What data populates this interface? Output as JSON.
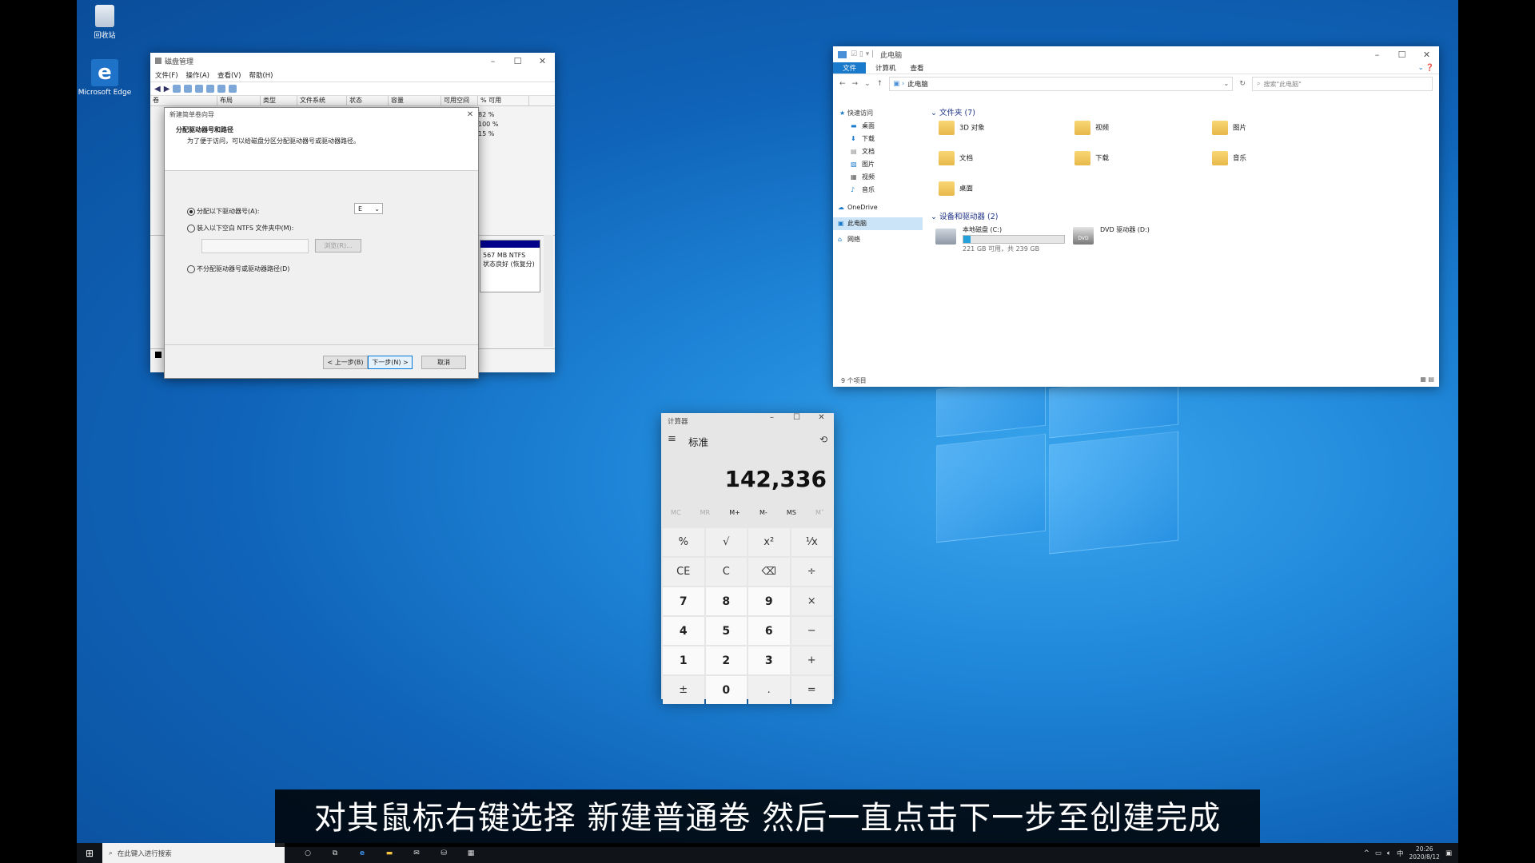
{
  "desktop": {
    "icons": [
      {
        "label": "回收站",
        "icon": "recycle-bin-icon"
      },
      {
        "label": "Microsoft Edge",
        "icon": "edge-icon"
      }
    ]
  },
  "disk_mgmt": {
    "title": "磁盘管理",
    "menu": [
      "文件(F)",
      "操作(A)",
      "查看(V)",
      "帮助(H)"
    ],
    "columns": [
      "卷",
      "布局",
      "类型",
      "文件系统",
      "状态",
      "容量",
      "可用空间",
      "% 可用"
    ],
    "pct_values": [
      "82 %",
      "100 %",
      "15 %"
    ],
    "partition_label": "567 MB NTFS",
    "partition_status": "状态良好 (恢复分)"
  },
  "wizard": {
    "title": "新建简单卷向导",
    "heading": "分配驱动器号和路径",
    "desc": "为了便于访问，可以给磁盘分区分配驱动器号或驱动器路径。",
    "opt1": "分配以下驱动器号(A):",
    "opt2": "装入以下空白 NTFS 文件夹中(M):",
    "opt3": "不分配驱动器号或驱动器路径(D)",
    "drive_letter": "E",
    "browse": "浏览(R)...",
    "back": "< 上一步(B)",
    "next": "下一步(N) >",
    "cancel": "取消"
  },
  "explorer": {
    "title": "此电脑",
    "ribbon_tabs": [
      "文件",
      "计算机",
      "查看"
    ],
    "address": "此电脑",
    "search_placeholder": "搜索\"此电脑\"",
    "nav": [
      "快速访问",
      "桌面",
      "下载",
      "文档",
      "图片",
      "视频",
      "音乐",
      "OneDrive",
      "此电脑",
      "网络"
    ],
    "folders_header": "文件夹 (7)",
    "folders": [
      "3D 对象",
      "视频",
      "图片",
      "文档",
      "下载",
      "音乐",
      "桌面"
    ],
    "devices_header": "设备和驱动器 (2)",
    "drive_c": "本地磁盘 (C:)",
    "drive_c_space": "221 GB 可用，共 239 GB",
    "drive_c_used_fraction": 0.075,
    "drive_d": "DVD 驱动器 (D:)",
    "status": "9 个项目"
  },
  "calculator": {
    "title": "计算器",
    "mode": "标准",
    "display": "142,336",
    "memory": [
      "MC",
      "MR",
      "M+",
      "M-",
      "MS",
      "M˅"
    ],
    "keys": [
      "%",
      "√",
      "x²",
      "¹⁄x",
      "CE",
      "C",
      "⌫",
      "÷",
      "7",
      "8",
      "9",
      "×",
      "4",
      "5",
      "6",
      "−",
      "1",
      "2",
      "3",
      "+",
      "±",
      "0",
      ".",
      "="
    ]
  },
  "taskbar": {
    "search_placeholder": "在此键入进行搜索",
    "time": "20:26",
    "date": "2020/8/12",
    "ime": "中"
  },
  "subtitle": "对其鼠标右键选择 新建普通卷 然后一直点击下一步至创建完成"
}
